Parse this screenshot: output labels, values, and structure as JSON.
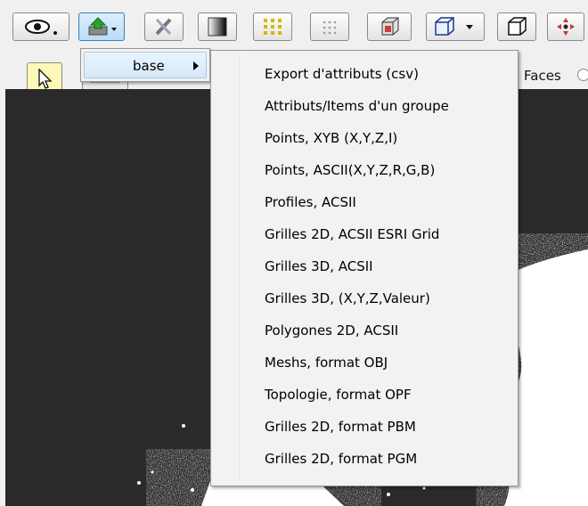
{
  "toolbar": {
    "row1_icons": [
      "eye-icon",
      "export-icon",
      "tools-icon",
      "gradient-icon",
      "grid-dots-yellow-icon",
      "grid-dots-icon",
      "cube-red-icon",
      "cube-dropdown-icon",
      "cube-icon",
      "crosshair-icon"
    ],
    "faces_label": "Faces"
  },
  "menu": {
    "submenu_label": "base",
    "items": [
      "Export d'attributs (csv)",
      "Attributs/Items d'un groupe",
      "Points, XYB (X,Y,Z,I)",
      "Points, ASCII(X,Y,Z,R,G,B)",
      "Profiles, ACSII",
      "Grilles 2D, ACSII ESRI Grid",
      "Grilles 3D, ACSII",
      "Grilles 3D, (X,Y,Z,Valeur)",
      "Polygones 2D, ACSII",
      "Meshs, format OBJ",
      "Topologie, format OPF",
      "Grilles 2D, format PBM",
      "Grilles 2D, format PGM"
    ]
  },
  "colors": {
    "viewport_bg": "#2a2a2a",
    "menu_bg": "#f2f2f2",
    "highlight": "#d6e8f8"
  }
}
